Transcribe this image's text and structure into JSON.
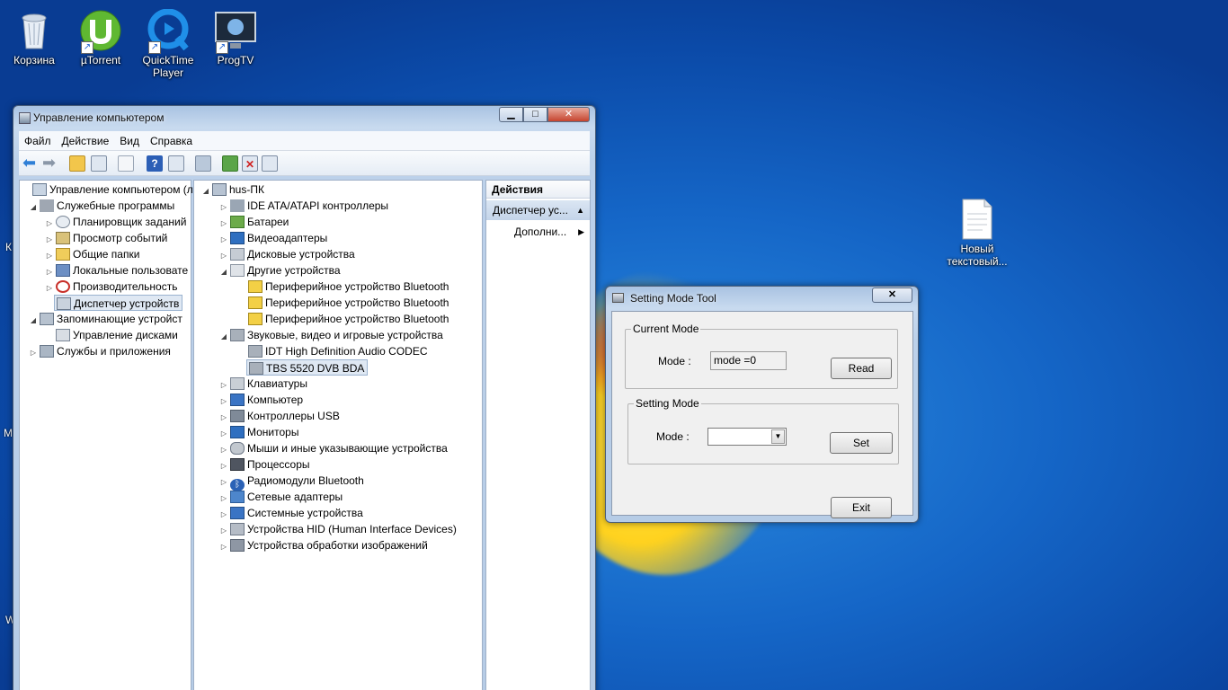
{
  "desktop": {
    "icons": [
      {
        "label": "Корзина",
        "icon": "recycle-bin-icon"
      },
      {
        "label": "µTorrent",
        "icon": "utorrent-icon"
      },
      {
        "label": "QuickTime Player",
        "icon": "quicktime-icon"
      },
      {
        "label": "ProgTV",
        "icon": "progtv-icon"
      },
      {
        "label": "Новый текстовый...",
        "icon": "text-file-icon"
      }
    ]
  },
  "mgmt": {
    "title": "Управление компьютером",
    "menu": [
      "Файл",
      "Действие",
      "Вид",
      "Справка"
    ],
    "left_tree": [
      {
        "label": "Управление компьютером (л",
        "level": 0
      },
      {
        "label": "Служебные программы",
        "level": 1
      },
      {
        "label": "Планировщик заданий",
        "level": 2
      },
      {
        "label": "Просмотр событий",
        "level": 2
      },
      {
        "label": "Общие папки",
        "level": 2
      },
      {
        "label": "Локальные пользовате",
        "level": 2
      },
      {
        "label": "Производительность",
        "level": 2
      },
      {
        "label": "Диспетчер устройств",
        "level": 2
      },
      {
        "label": "Запоминающие устройст",
        "level": 1
      },
      {
        "label": "Управление дисками",
        "level": 2
      },
      {
        "label": "Службы и приложения",
        "level": 1
      }
    ],
    "device_tree": [
      "hus-ПК",
      "IDE ATA/ATAPI контроллеры",
      "Батареи",
      "Видеоадаптеры",
      "Дисковые устройства",
      "Другие устройства",
      "Периферийное устройство Bluetooth",
      "Периферийное устройство Bluetooth",
      "Периферийное устройство Bluetooth",
      "Звуковые, видео и игровые устройства",
      "IDT High Definition Audio CODEC",
      "TBS 5520 DVB BDA",
      "Клавиатуры",
      "Компьютер",
      "Контроллеры USB",
      "Мониторы",
      "Мыши и иные указывающие устройства",
      "Процессоры",
      "Радиомодули Bluetooth",
      "Сетевые адаптеры",
      "Системные устройства",
      "Устройства HID (Human Interface Devices)",
      "Устройства обработки изображений"
    ],
    "actions": {
      "header": "Действия",
      "item": "Диспетчер ус...",
      "sub": "Дополни..."
    }
  },
  "dialog": {
    "title": "Setting Mode Tool",
    "current_group": "Current Mode",
    "mode_label": "Mode :",
    "mode_value": "mode =0",
    "read": "Read",
    "setting_group": "Setting Mode",
    "mode_label2": "Mode :",
    "set": "Set",
    "exit": "Exit",
    "close": "✕"
  },
  "edge_letters": [
    "К",
    "М",
    "W"
  ]
}
